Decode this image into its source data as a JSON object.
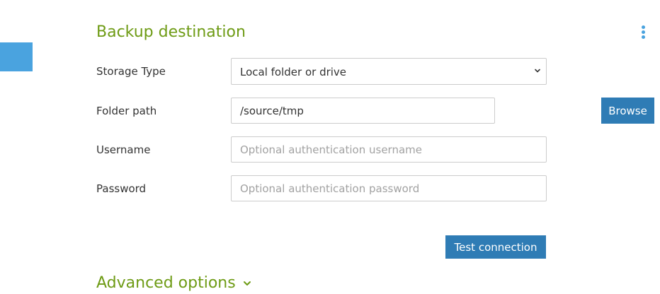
{
  "section": {
    "title": "Backup destination",
    "menu_icon": "kebab-vertical-icon"
  },
  "colors": {
    "accent_green": "#6e9b15",
    "accent_blue": "#4aa3df",
    "button_blue": "#2f7cb5"
  },
  "storage_type": {
    "label": "Storage Type",
    "value": "Local folder or drive"
  },
  "folder_path": {
    "label": "Folder path",
    "value": "/source/tmp",
    "browse_label": "Browse"
  },
  "username": {
    "label": "Username",
    "value": "",
    "placeholder": "Optional authentication username"
  },
  "password": {
    "label": "Password",
    "value": "",
    "placeholder": "Optional authentication password"
  },
  "test_connection_label": "Test connection",
  "advanced": {
    "label": "Advanced options",
    "icon": "chevron-down-icon"
  }
}
